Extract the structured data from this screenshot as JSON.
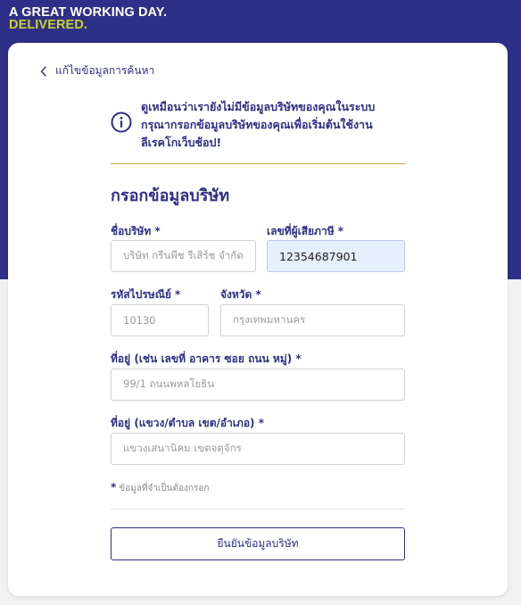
{
  "brand": {
    "line1": "A GREAT WORKING DAY.",
    "line2": "DELIVERED."
  },
  "nav": {
    "back_label": "แก้ไขข้อมูลการค้นหา"
  },
  "notice": {
    "line1": "ดูเหมือนว่าเรายังไม่มีข้อมูลบริษัทของคุณในระบบ",
    "line2": "กรุณากรอกข้อมูลบริษัทของคุณเพื่อเริ่มต้นใช้งาน",
    "line3": "ลีเรคโกเว็บช้อป!"
  },
  "form": {
    "title": "กรอกข้อมูลบริษัท",
    "company_name": {
      "label": "ชื่อบริษัท *",
      "placeholder": "บริษัท กรีนพีช รีเสิร์ช จำกัด",
      "value": ""
    },
    "tax_id": {
      "label": "เลขที่ผู้เสียภาษี *",
      "placeholder": "",
      "value": "12354687901"
    },
    "postal_code": {
      "label": "รหัสไปรษณีย์ *",
      "placeholder": "10130",
      "value": ""
    },
    "province": {
      "label": "จังหวัด *",
      "placeholder": "กรุงเทพมหานคร",
      "value": ""
    },
    "address": {
      "label": "ที่อยู่ (เช่น เลขที่ อาคาร ซอย ถนน หมู่) *",
      "placeholder": "99/1 ถนนพหลโยธิน",
      "value": ""
    },
    "district": {
      "label": "ที่อยู่ (แขวง/ตำบล เขต/อำเภอ) *",
      "placeholder": "แขวงเสนานิคม เขตจตุจักร",
      "value": ""
    },
    "required_star": "*",
    "required_note": "ข้อมูลที่จำเป็นต้องกรอก",
    "submit_label": "ยืนยันข้อมูลบริษัท"
  },
  "colors": {
    "primary": "#2e2f86",
    "accent": "#c8d22f",
    "divider_gold": "#c0a248",
    "filled_input_bg": "#e6effc"
  },
  "icons": {
    "back": "chevron-left-icon",
    "info": "info-circle-icon"
  }
}
